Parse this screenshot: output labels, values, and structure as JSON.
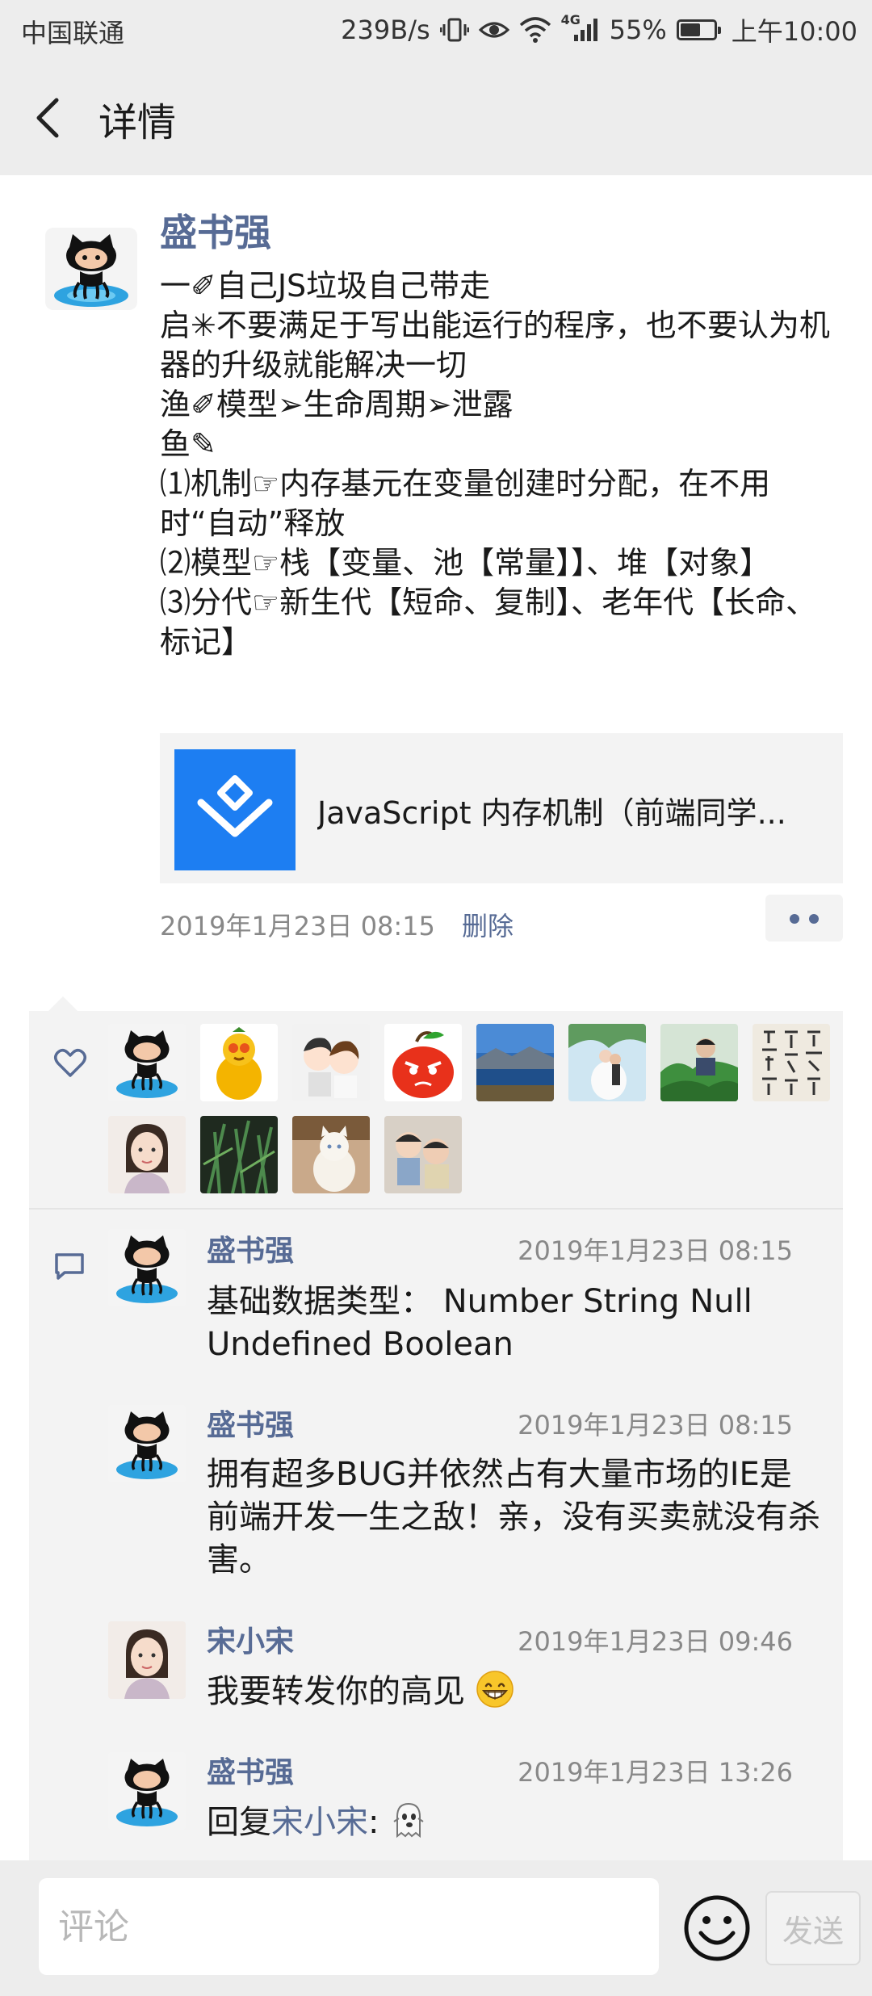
{
  "status_bar": {
    "carrier": "中国联通",
    "net_speed": "239B/s",
    "network_type": "4G",
    "battery": "55%",
    "time": "上午10:00"
  },
  "header": {
    "title": "详情"
  },
  "post": {
    "author": "盛书强",
    "lines": [
      "一✐自己JS垃圾自己带走",
      "启✳不要满足于写出能运行的程序，也不要认为机器的升级就能解决一切",
      "渔✐模型➢生命周期➢泄露",
      "鱼✎",
      "⑴机制☞内存基元在变量创建时分配，在不用时“自动”释放",
      "⑵模型☞栈【变量、池【常量】】、堆【对象】",
      "⑶分代☞新生代【短命、复制】、老年代【长命、标记】"
    ],
    "link_title": "JavaScript 内存机制（前端同学...",
    "time": "2019年1月23日 08:15",
    "delete_label": "删除"
  },
  "likes": {
    "icon": "heart-icon",
    "avatars": [
      "github-octocat-avatar",
      "gourd-cartoon-avatar",
      "anime-couple-avatar",
      "angry-fruit-avatar",
      "landscape-lake-avatar",
      "wedding-photo-avatar",
      "man-with-plants-avatar",
      "calligraphy-avatar",
      "girl-selfie-avatar",
      "plants-avatar",
      "white-cat-avatar",
      "children-photo-avatar"
    ]
  },
  "comments": [
    {
      "author": "盛书强",
      "time": "2019年1月23日 08:15",
      "text": "基础数据类型： Number String Null Undefined Boolean",
      "avatar": "github-octocat-avatar"
    },
    {
      "author": "盛书强",
      "time": "2019年1月23日 08:15",
      "text": "拥有超多BUG并依然占有大量市场的IE是前端开发一生之敌！亲，没有买卖就没有杀害。",
      "avatar": "github-octocat-avatar"
    },
    {
      "author": "宋小宋",
      "time": "2019年1月23日 09:46",
      "text": "我要转发你的高见",
      "emoji": "grinning-face-emoji",
      "avatar": "girl-selfie-avatar"
    },
    {
      "author": "盛书强",
      "time": "2019年1月23日 13:26",
      "reply_prefix": "回复",
      "reply_to": "宋小宋",
      "reply_sep": ":",
      "emoji": "ghost-emoji",
      "avatar": "github-octocat-avatar"
    }
  ],
  "input": {
    "placeholder": "评论",
    "send_label": "发送"
  },
  "colors": {
    "link_blue": "#576b95",
    "link_card_icon": "#1d7ef2",
    "background_gray": "#ededed"
  }
}
